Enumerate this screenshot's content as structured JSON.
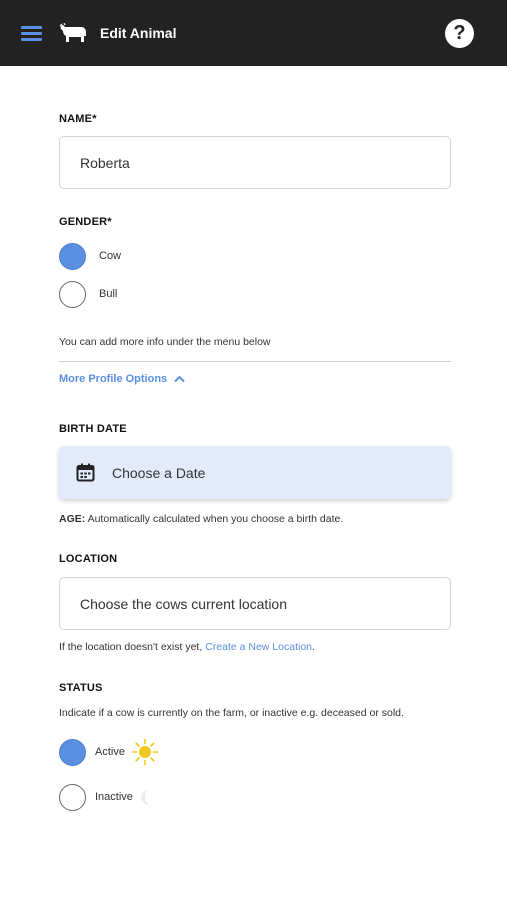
{
  "header": {
    "title": "Edit Animal",
    "help_label": "?",
    "menu_icon": "hamburger-menu-icon",
    "logo_icon": "cow-logo-icon"
  },
  "name": {
    "label": "NAME*",
    "value": "Roberta"
  },
  "gender": {
    "label": "GENDER*",
    "options": [
      {
        "label": "Cow",
        "selected": true
      },
      {
        "label": "Bull",
        "selected": false
      }
    ]
  },
  "info_note": "You can add more info under the menu below",
  "more_options": {
    "label": "More Profile Options",
    "icon": "chevron-up-icon"
  },
  "birth_date": {
    "label": "BIRTH DATE",
    "button_label": "Choose a Date",
    "icon": "calendar-icon",
    "age_prefix": "AGE:",
    "age_note": "Automatically calculated when you choose a birth date."
  },
  "location": {
    "label": "LOCATION",
    "placeholder": "Choose the cows current location",
    "note_prefix": "If the location doesn't exist yet,",
    "note_link": "Create a New Location",
    "note_suffix": "."
  },
  "status": {
    "label": "STATUS",
    "description": "Indicate if a cow is currently on the farm, or inactive e.g. deceased or sold.",
    "options": [
      {
        "label": "Active",
        "selected": true,
        "icon": "sun-icon"
      },
      {
        "label": "Inactive",
        "selected": false,
        "icon": "moon-icon"
      }
    ]
  },
  "colors": {
    "header_bg": "#222222",
    "accent": "#5b8fe0",
    "date_button_bg": "#e3eaf9",
    "sun": "#f2c81d"
  }
}
